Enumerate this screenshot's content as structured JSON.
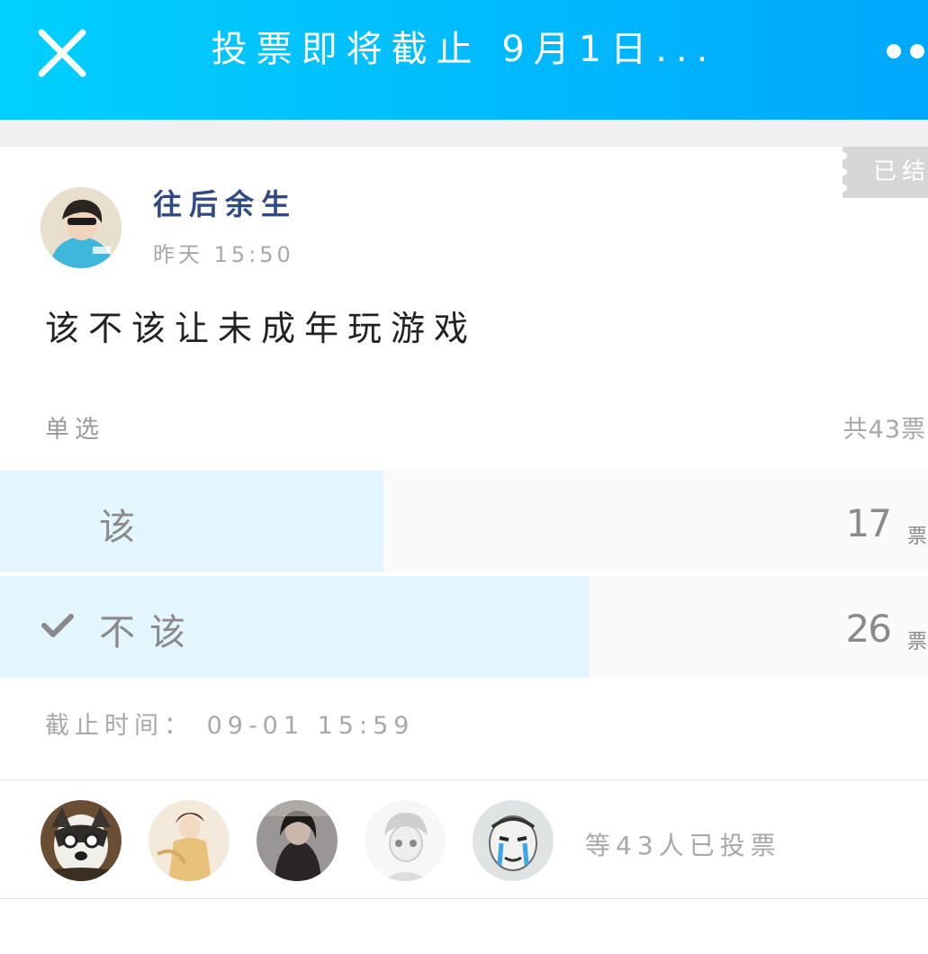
{
  "header": {
    "title": "投票即将截止 9月1日...",
    "close_icon": "close-icon",
    "more_icon": "more-dots-icon",
    "gradient_start": "#00d0ff",
    "gradient_end": "#00a8fc"
  },
  "post": {
    "status_tag": "已结",
    "author": "往后余生",
    "time": "昨天 15:50",
    "question": "该不该让未成年玩游戏"
  },
  "poll": {
    "mode": "单选",
    "total": "共43票",
    "options": [
      {
        "label": "该",
        "votes": "17",
        "unit": "票",
        "fraction": 0.413,
        "selected": false
      },
      {
        "label": "不该",
        "votes": "26",
        "unit": "票",
        "fraction": 0.635,
        "selected": true
      }
    ],
    "fill_color": "#e3f5fd",
    "check_icon": "checkmark-icon",
    "deadline": "截止时间： 09-01 15:59"
  },
  "voters": {
    "summary": "等43人已投票",
    "avatar_count": 5
  }
}
